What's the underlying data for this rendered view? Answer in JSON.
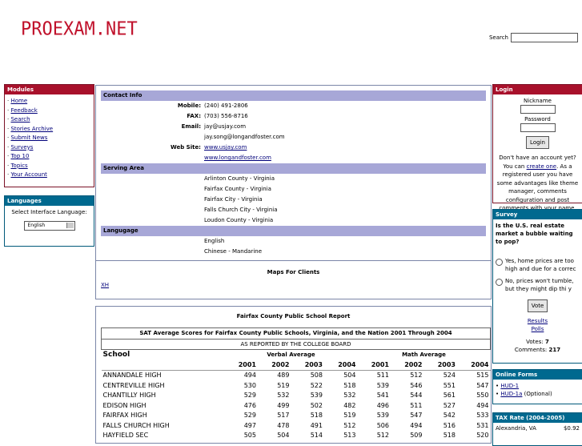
{
  "header": {
    "logo": "PROEXAM.NET",
    "search_label": "Search"
  },
  "modules": {
    "title": "Modules",
    "items": [
      "Home",
      "Feedback",
      "Search",
      "Stories Archive",
      "Submit News",
      "Surveys",
      "Top 10",
      "Topics",
      "Your Account"
    ]
  },
  "languages": {
    "title": "Languages",
    "prompt": "Select Interface Language:",
    "selected": "English"
  },
  "contact": {
    "section_title": "Contact Info",
    "mobile_label": "Mobile:",
    "mobile": "(240) 491-2806",
    "fax_label": "FAX:",
    "fax": "(703) 556-8716",
    "email_label": "Email:",
    "email1": "jay@usjay.com",
    "email2": "jay.song@longandfoster.com",
    "web_label": "Web Site:",
    "web1": "www.usjay.com",
    "web2": "www.longandfoster.com",
    "serving_title": "Serving Area",
    "areas": [
      "Arlinton County - Virginia",
      "Fairfax County - Virginia",
      "Fairfax City - Virginia",
      "Falls Church City - Virginia",
      "Loudon County - Virginia"
    ],
    "language_title": "Langugage",
    "languages": [
      "English",
      "Chinese - Mandarine"
    ]
  },
  "maps": {
    "title": "Maps For Clients",
    "link": "XH"
  },
  "report": {
    "title": "Fairfax County Public School Report",
    "subtitle": "SAT Average Scores for Fairfax County Public Schools, Virginia, and the Nation 2001 Through 2004",
    "source": "AS REPORTED BY THE COLLEGE BOARD",
    "school_header": "School",
    "verbal_header": "Verbal Average",
    "math_header": "Math Average",
    "years": [
      "2001",
      "2002",
      "2003",
      "2004",
      "2001",
      "2002",
      "2003",
      "2004"
    ],
    "rows": [
      {
        "name": "ANNANDALE HIGH",
        "v": [
          "494",
          "489",
          "508",
          "504",
          "511",
          "512",
          "524",
          "515"
        ]
      },
      {
        "name": "CENTREVILLE HIGH",
        "v": [
          "530",
          "519",
          "522",
          "518",
          "539",
          "546",
          "551",
          "547"
        ]
      },
      {
        "name": "CHANTILLY HIGH",
        "v": [
          "529",
          "532",
          "539",
          "532",
          "541",
          "544",
          "561",
          "550"
        ]
      },
      {
        "name": "EDISON HIGH",
        "v": [
          "476",
          "499",
          "502",
          "482",
          "496",
          "511",
          "527",
          "494"
        ]
      },
      {
        "name": "FAIRFAX HIGH",
        "v": [
          "529",
          "517",
          "518",
          "519",
          "539",
          "547",
          "542",
          "533"
        ]
      },
      {
        "name": "FALLS CHURCH HIGH",
        "v": [
          "497",
          "478",
          "491",
          "512",
          "506",
          "494",
          "516",
          "531"
        ]
      },
      {
        "name": "HAYFIELD SEC",
        "v": [
          "505",
          "504",
          "514",
          "513",
          "512",
          "509",
          "518",
          "520"
        ]
      }
    ]
  },
  "login": {
    "title": "Login",
    "nickname_label": "Nickname",
    "password_label": "Password",
    "button": "Login",
    "text_before": "Don't have an account yet? You can ",
    "create_link": "create one",
    "text_after": ". As a registered user you have some advantages like theme manager, comments configuration and post comments with your name."
  },
  "survey": {
    "title": "Survey",
    "question": "Is the U.S. real estate market a bubble waiting to pop?",
    "options": [
      "Yes, home prices are too high and due for a correc",
      "No, prices won't tumble, but they might dip thi y"
    ],
    "vote_button": "Vote",
    "results_link": "Results",
    "polls_link": "Polls",
    "votes_label": "Votes:",
    "votes": "7",
    "comments_label": "Comments:",
    "comments": "217"
  },
  "online_forms": {
    "title": "Online Forms",
    "items": [
      "HUD-1",
      "HUD-1a"
    ],
    "hud1a_note": "(Optional)"
  },
  "tax": {
    "title": "TAX Rate (2004-2005)",
    "rows": [
      {
        "name": "Alexandria, VA",
        "rate": "$0.92"
      }
    ]
  }
}
